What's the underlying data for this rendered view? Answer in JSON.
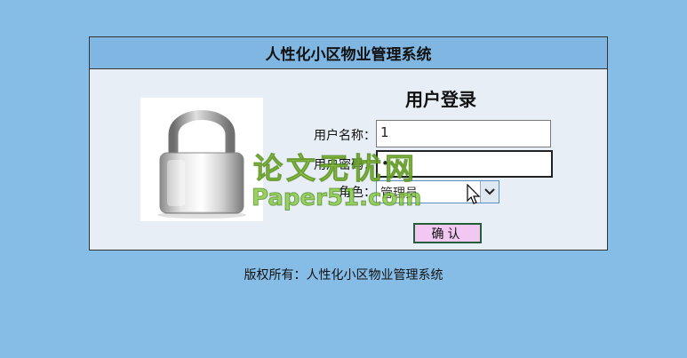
{
  "header": {
    "title": "人性化小区物业管理系统"
  },
  "login": {
    "title": "用户登录",
    "username_label": "用户名称：",
    "username_value": "1",
    "password_label": "用户密码：",
    "password_value": "•",
    "role_label": "角色：",
    "role_selected": "管理员",
    "confirm_label": "确认"
  },
  "footer": {
    "copyright": "版权所有：人性化小区物业管理系统"
  },
  "watermark": {
    "line1": "论文无忧网",
    "line2": "Paper51.com"
  },
  "colors": {
    "page_bg": "#86bde6",
    "header_bg": "#7fb6e2",
    "panel_bg": "#e8eef5",
    "button_bg": "#f2c8f3",
    "button_border": "#245f3c"
  },
  "icons": {
    "lock": "padlock-icon",
    "dropdown": "chevron-down-icon",
    "cursor": "mouse-pointer-icon"
  }
}
